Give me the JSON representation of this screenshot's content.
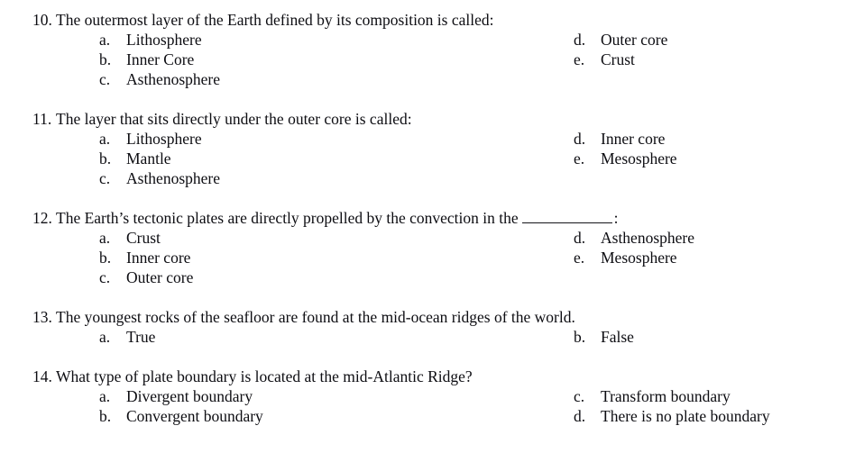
{
  "document": {
    "type": "multiple-choice-quiz",
    "background_color": "#ffffff",
    "text_color": "#0d0d12"
  },
  "questions": [
    {
      "number": "10.",
      "stem": "The outermost layer of the Earth defined by its composition is called:",
      "stem_tail": "",
      "has_blank": false,
      "rows": [
        {
          "left_letter": "a.",
          "left_text": "Lithosphere",
          "right_letter": "d.",
          "right_text": "Outer core"
        },
        {
          "left_letter": "b.",
          "left_text": "Inner Core",
          "right_letter": "e.",
          "right_text": "Crust"
        },
        {
          "left_letter": "c.",
          "left_text": "Asthenosphere",
          "right_letter": "",
          "right_text": ""
        }
      ]
    },
    {
      "number": "11.",
      "stem": "The layer that sits directly under the outer core is called:",
      "stem_tail": "",
      "has_blank": false,
      "rows": [
        {
          "left_letter": "a.",
          "left_text": "Lithosphere",
          "right_letter": "d.",
          "right_text": "Inner core"
        },
        {
          "left_letter": "b.",
          "left_text": "Mantle",
          "right_letter": "e.",
          "right_text": "Mesosphere"
        },
        {
          "left_letter": "c.",
          "left_text": "Asthenosphere",
          "right_letter": "",
          "right_text": ""
        }
      ]
    },
    {
      "number": "12.",
      "stem": "The Earth’s tectonic plates are directly propelled by the convection in the",
      "stem_tail": ":",
      "has_blank": true,
      "rows": [
        {
          "left_letter": "a.",
          "left_text": "Crust",
          "right_letter": "d.",
          "right_text": "Asthenosphere"
        },
        {
          "left_letter": "b.",
          "left_text": "Inner core",
          "right_letter": "e.",
          "right_text": "Mesosphere"
        },
        {
          "left_letter": "c.",
          "left_text": "Outer core",
          "right_letter": "",
          "right_text": ""
        }
      ]
    },
    {
      "number": "13.",
      "stem": "The youngest rocks of the seafloor are found at the mid-ocean ridges of the world.",
      "stem_tail": "",
      "has_blank": false,
      "rows": [
        {
          "left_letter": "a.",
          "left_text": "True",
          "right_letter": "b.",
          "right_text": "False"
        }
      ]
    },
    {
      "number": "14.",
      "stem": "What type of plate boundary is located at the mid-Atlantic Ridge?",
      "stem_tail": "",
      "has_blank": false,
      "rows": [
        {
          "left_letter": "a.",
          "left_text": "Divergent boundary",
          "right_letter": "c.",
          "right_text": "Transform boundary"
        },
        {
          "left_letter": "b.",
          "left_text": "Convergent boundary",
          "right_letter": "d.",
          "right_text": "There is no plate boundary"
        }
      ]
    }
  ]
}
